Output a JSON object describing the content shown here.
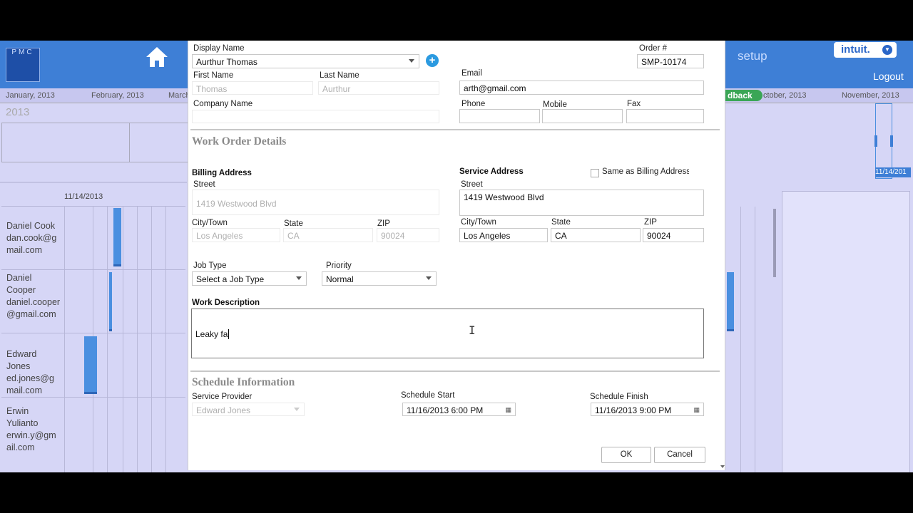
{
  "app": {
    "logo_text": "PMC",
    "setup_label": "setup",
    "intuit_label": "intuit.",
    "logout_label": "Logout",
    "feedback_label": "dback",
    "year_label": "2013",
    "months": [
      "January, 2013",
      "February, 2013",
      "March",
      "ctober, 2013",
      "November, 2013"
    ],
    "selected_date": "11/14/2013",
    "sel_badge": "11/14/201",
    "people": [
      "Daniel Cook dan.cook@g mail.com",
      "Daniel Cooper daniel.cooper @gmail.com",
      "Edward Jones ed.jones@g mail.com",
      "Erwin Yulianto erwin.y@gm ail.com"
    ],
    "icons": {
      "home": "home-icon",
      "intuit_dropdown": "chevron-down-icon"
    },
    "colors": {
      "topbar": "#3e7fd6",
      "background": "#d6d6f6",
      "feedback": "#3aa656",
      "accent": "#2b9ae0"
    }
  },
  "dialog": {
    "customer": {
      "display_name_label": "Display Name",
      "display_name_value": "Aurthur Thomas",
      "first_name_label": "First Name",
      "first_name_value": "Thomas",
      "last_name_label": "Last Name",
      "last_name_value": "Aurthur",
      "company_label": "Company Name",
      "company_value": "",
      "order_label": "Order #",
      "order_value": "SMP-10174",
      "email_label": "Email",
      "email_value": "arth@gmail.com",
      "phone_label": "Phone",
      "mobile_label": "Mobile",
      "fax_label": "Fax"
    },
    "work_order": {
      "section_title": "Work Order Details",
      "billing_title": "Billing Address",
      "service_title": "Service Address",
      "same_as_billing_label": "Same as Billing Address",
      "same_as_billing_checked": false,
      "street_label": "Street",
      "city_label": "City/Town",
      "state_label": "State",
      "zip_label": "ZIP",
      "billing": {
        "street": "1419 Westwood Blvd",
        "city": "Los Angeles",
        "state": "CA",
        "zip": "90024"
      },
      "service": {
        "street": "1419 Westwood Blvd",
        "city": "Los Angeles",
        "state": "CA",
        "zip": "90024"
      },
      "job_type_label": "Job Type",
      "job_type_value": "Select a Job Type",
      "priority_label": "Priority",
      "priority_value": "Normal",
      "description_label": "Work Description",
      "description_value": "Leaky fa"
    },
    "schedule": {
      "section_title": "Schedule Information",
      "provider_label": "Service Provider",
      "provider_value": "Edward Jones",
      "start_label": "Schedule Start",
      "start_value": "11/16/2013 6:00 PM",
      "finish_label": "Schedule Finish",
      "finish_value": "11/16/2013 9:00 PM"
    },
    "buttons": {
      "ok": "OK",
      "cancel": "Cancel"
    }
  }
}
